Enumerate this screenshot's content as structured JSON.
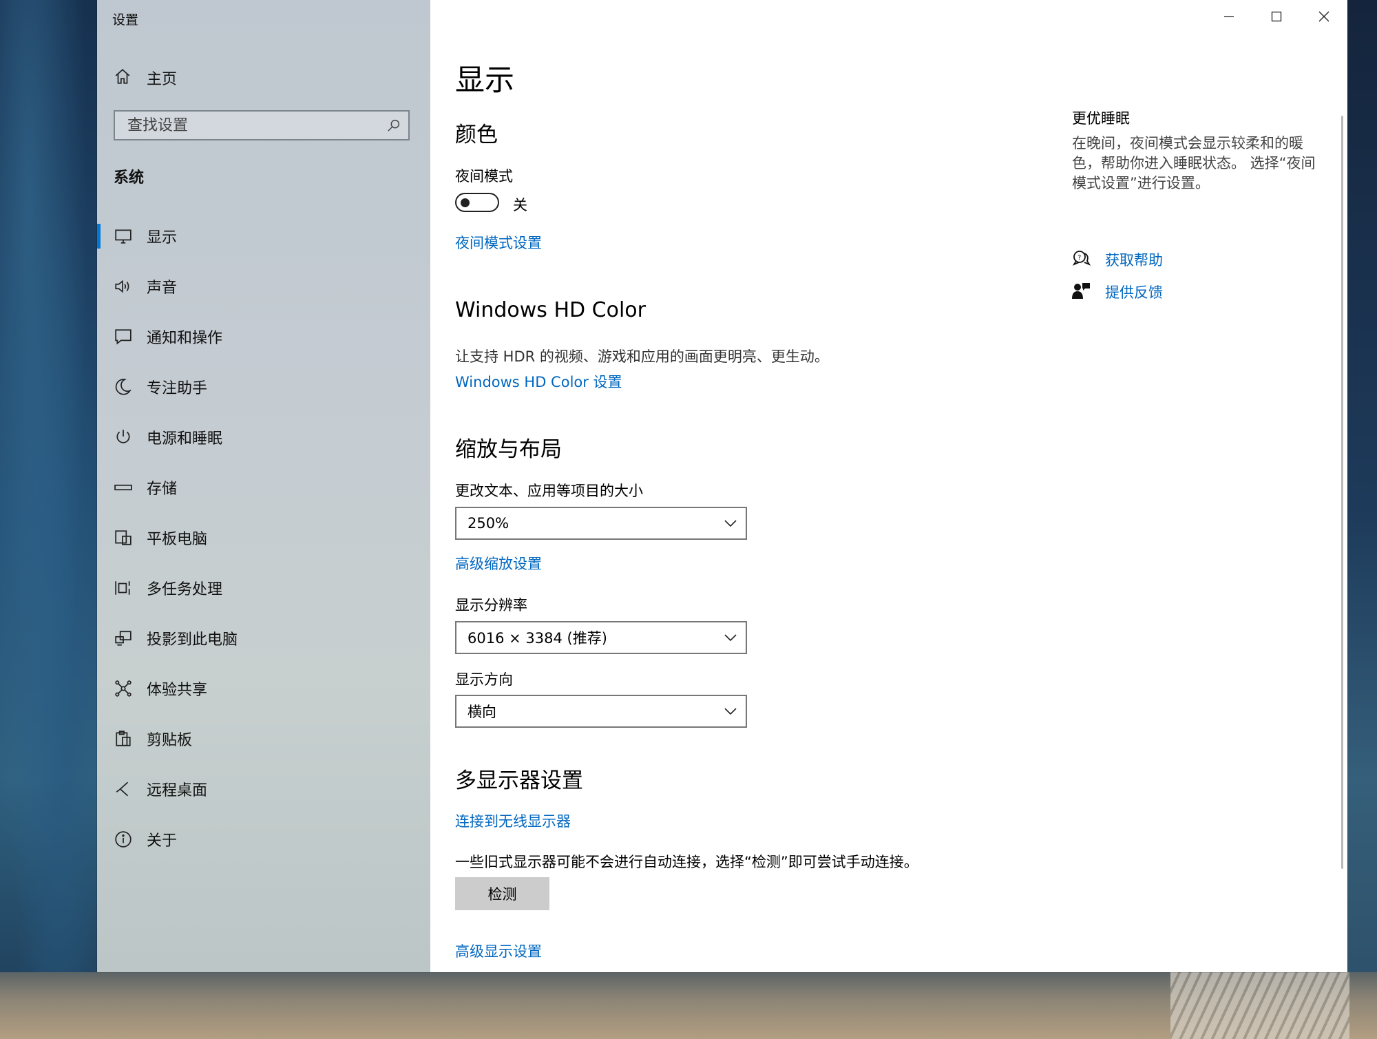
{
  "window": {
    "app_title": "设置",
    "controls": [
      "minimize-icon",
      "maximize-icon",
      "close-icon"
    ]
  },
  "sidebar": {
    "home_label": "主页",
    "search_placeholder": "查找设置",
    "section_label": "系统",
    "active_index": 0,
    "items": [
      {
        "label": "显示",
        "icon": "monitor-icon"
      },
      {
        "label": "声音",
        "icon": "speaker-icon"
      },
      {
        "label": "通知和操作",
        "icon": "message-icon"
      },
      {
        "label": "专注助手",
        "icon": "moon-icon"
      },
      {
        "label": "电源和睡眠",
        "icon": "power-icon"
      },
      {
        "label": "存储",
        "icon": "storage-icon"
      },
      {
        "label": "平板电脑",
        "icon": "tablet-icon"
      },
      {
        "label": "多任务处理",
        "icon": "multitask-icon"
      },
      {
        "label": "投影到此电脑",
        "icon": "project-icon"
      },
      {
        "label": "体验共享",
        "icon": "share-icon"
      },
      {
        "label": "剪贴板",
        "icon": "clipboard-icon"
      },
      {
        "label": "远程桌面",
        "icon": "remote-desktop-icon"
      },
      {
        "label": "关于",
        "icon": "info-icon"
      }
    ]
  },
  "main": {
    "page_title": "显示",
    "color": {
      "heading": "颜色",
      "night_mode_label": "夜间模式",
      "night_mode_state": "关",
      "night_mode_on": false,
      "night_mode_link": "夜间模式设置"
    },
    "hdr": {
      "heading": "Windows HD Color",
      "description": "让支持 HDR 的视频、游戏和应用的画面更明亮、更生动。",
      "link": "Windows HD Color 设置"
    },
    "scale": {
      "heading": "缩放与布局",
      "size_label": "更改文本、应用等项目的大小",
      "size_value": "250%",
      "advanced_link": "高级缩放设置",
      "resolution_label": "显示分辨率",
      "resolution_value": "6016 × 3384 (推荐)",
      "orientation_label": "显示方向",
      "orientation_value": "横向"
    },
    "multi": {
      "heading": "多显示器设置",
      "wireless_link": "连接到无线显示器",
      "description": "一些旧式显示器可能不会进行自动连接，选择“检测”即可尝试手动连接。",
      "detect_button": "检测",
      "advanced_link": "高级显示设置"
    }
  },
  "right_panel": {
    "title": "更优睡眠",
    "description": "在晚间，夜间模式会显示较柔和的暖色，帮助你进入睡眠状态。 选择“夜间模式设置”进行设置。",
    "help_link": "获取帮助",
    "feedback_link": "提供反馈"
  },
  "colors": {
    "accent": "#0078d7",
    "link": "#0067c0"
  }
}
